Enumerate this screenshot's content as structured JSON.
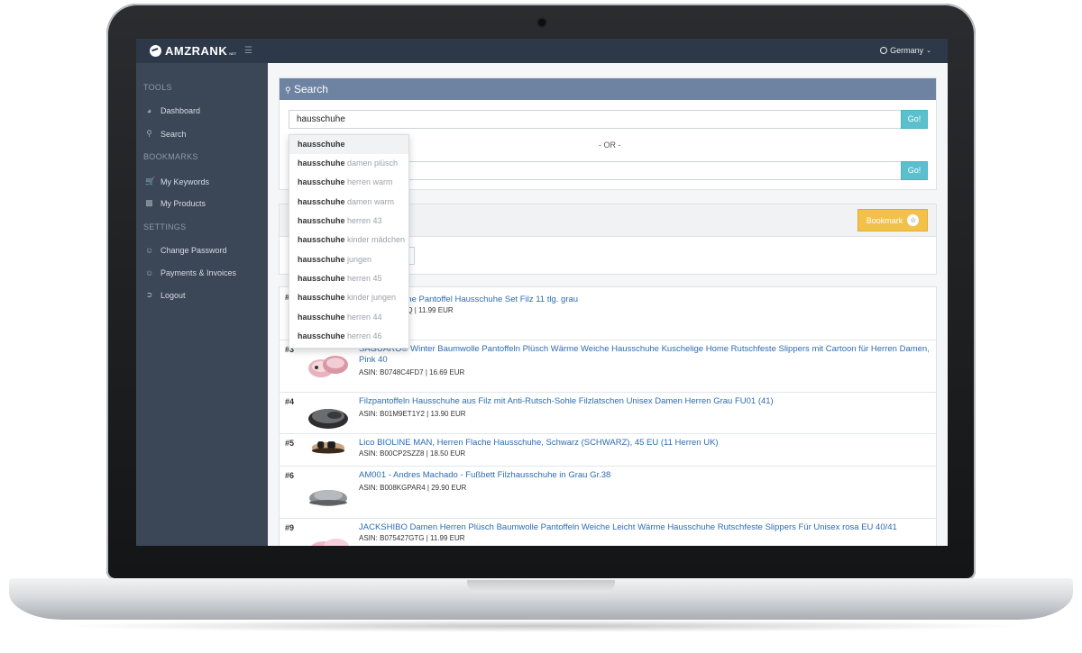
{
  "topbar": {
    "logo_text": "AMZRANK",
    "logo_sub": "NET",
    "country": "Germany"
  },
  "sidebar": {
    "sections": [
      {
        "label": "TOOLS"
      },
      {
        "label": "BOOKMARKS"
      },
      {
        "label": "SETTINGS"
      }
    ],
    "items": [
      {
        "label": "Dashboard",
        "icon": "dashboard-icon"
      },
      {
        "label": "Search",
        "icon": "search-icon"
      },
      {
        "label": "My Keywords",
        "icon": "cart-icon"
      },
      {
        "label": "My Products",
        "icon": "briefcase-icon"
      },
      {
        "label": "Change Password",
        "icon": "user-icon"
      },
      {
        "label": "Payments & Invoices",
        "icon": "user-icon"
      },
      {
        "label": "Logout",
        "icon": "logout-icon"
      }
    ]
  },
  "search": {
    "title": "Search",
    "keyword_value": "hausschuhe",
    "go_label": "Go!",
    "or_label": "- OR -",
    "go2_label": "Go!"
  },
  "suggestions": [
    {
      "bold": "hausschuhe",
      "rest": ""
    },
    {
      "bold": "hausschuhe",
      "rest": " damen plüsch"
    },
    {
      "bold": "hausschuhe",
      "rest": " herren warm"
    },
    {
      "bold": "hausschuhe",
      "rest": " damen warm"
    },
    {
      "bold": "hausschuhe",
      "rest": " herren 43"
    },
    {
      "bold": "hausschuhe",
      "rest": " kinder mädchen"
    },
    {
      "bold": "hausschuhe",
      "rest": " jungen"
    },
    {
      "bold": "hausschuhe",
      "rest": " herren 45"
    },
    {
      "bold": "hausschuhe",
      "rest": " kinder jungen"
    },
    {
      "bold": "hausschuhe",
      "rest": " herren 44"
    },
    {
      "bold": "hausschuhe",
      "rest": " herren 46"
    }
  ],
  "bookmark_label": "Bookmark",
  "results": [
    {
      "rank": "#",
      "title": "uhe Pantoffel Hausschuhe Set Filz 11 tlg. grau",
      "meta": "SQ | 11.99 EUR"
    },
    {
      "rank": "#3",
      "title": "SAGUARO® Winter Baumwolle Pantoffeln Plüsch Wärme Weiche Hausschuhe Kuschelige Home Rutschfeste Slippers mit Cartoon für Herren Damen, Pink 40",
      "meta": "ASIN: B0748C4FD7 | 16.69 EUR"
    },
    {
      "rank": "#4",
      "title": "Filzpantoffeln Hausschuhe aus Filz mit Anti-Rutsch-Sohle Filzlatschen Unisex Damen Herren Grau FU01 (41)",
      "meta": "ASIN: B01M9ET1Y2 | 13.90 EUR"
    },
    {
      "rank": "#5",
      "title": "Lico BIOLINE MAN, Herren Flache Hausschuhe, Schwarz (SCHWARZ), 45 EU (11 Herren UK)",
      "meta": "ASIN: B00CP2SZZ8 | 18.50 EUR"
    },
    {
      "rank": "#6",
      "title": "AM001 - Andres Machado - Fußbett Filzhausschuhe in Grau Gr.38",
      "meta": "ASIN: B008KGPAR4 | 29.90 EUR"
    },
    {
      "rank": "#9",
      "title": "JACKSHIBO Damen Herren Plüsch Baumwolle Pantoffeln Weiche Leicht Wärme Hausschuhe Rutschfeste Slippers Für Unisex rosa EU 40/41",
      "meta": "ASIN: B075427GTG | 11.99 EUR"
    }
  ],
  "colors": {
    "topbar": "#2d3848",
    "sidebar": "#3b4656",
    "panel_header": "#6d83a1",
    "go_button": "#5bc0cd",
    "bookmark_button": "#f2c14a",
    "link": "#2d6cb0"
  }
}
